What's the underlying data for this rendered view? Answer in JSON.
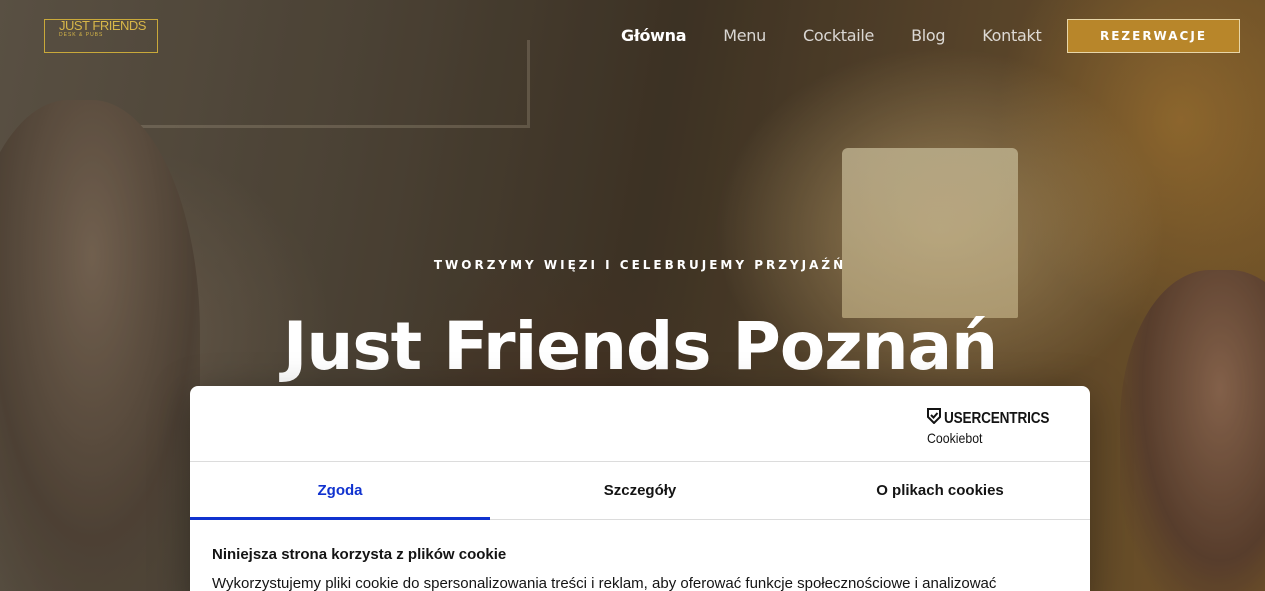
{
  "header": {
    "logo": {
      "main": "JUST FRIENDS",
      "sub": "DESK & PUBS"
    },
    "nav": [
      {
        "label": "Główna",
        "active": true
      },
      {
        "label": "Menu",
        "active": false
      },
      {
        "label": "Cocktaile",
        "active": false
      },
      {
        "label": "Blog",
        "active": false
      },
      {
        "label": "Kontakt",
        "active": false
      }
    ],
    "cta_label": "REZERWACJE",
    "accent_color": "#b8862a"
  },
  "hero": {
    "tagline": "TWORZYMY WIĘZI I CELEBRUJEMY PRZYJAŹŃ",
    "title": "Just Friends Poznań"
  },
  "cookie_banner": {
    "brand": {
      "name": "USERCENTRICS",
      "sub": "Cookiebot",
      "icon": "shield-check-icon"
    },
    "tabs": [
      {
        "label": "Zgoda",
        "active": true
      },
      {
        "label": "Szczegóły",
        "active": false
      },
      {
        "label": "O plikach cookies",
        "active": false
      }
    ],
    "active_color": "#1032cf",
    "heading": "Niniejsza strona korzysta z plików cookie",
    "text": "Wykorzystujemy pliki cookie do spersonalizowania treści i reklam, aby oferować funkcje społecznościowe i analizować"
  }
}
